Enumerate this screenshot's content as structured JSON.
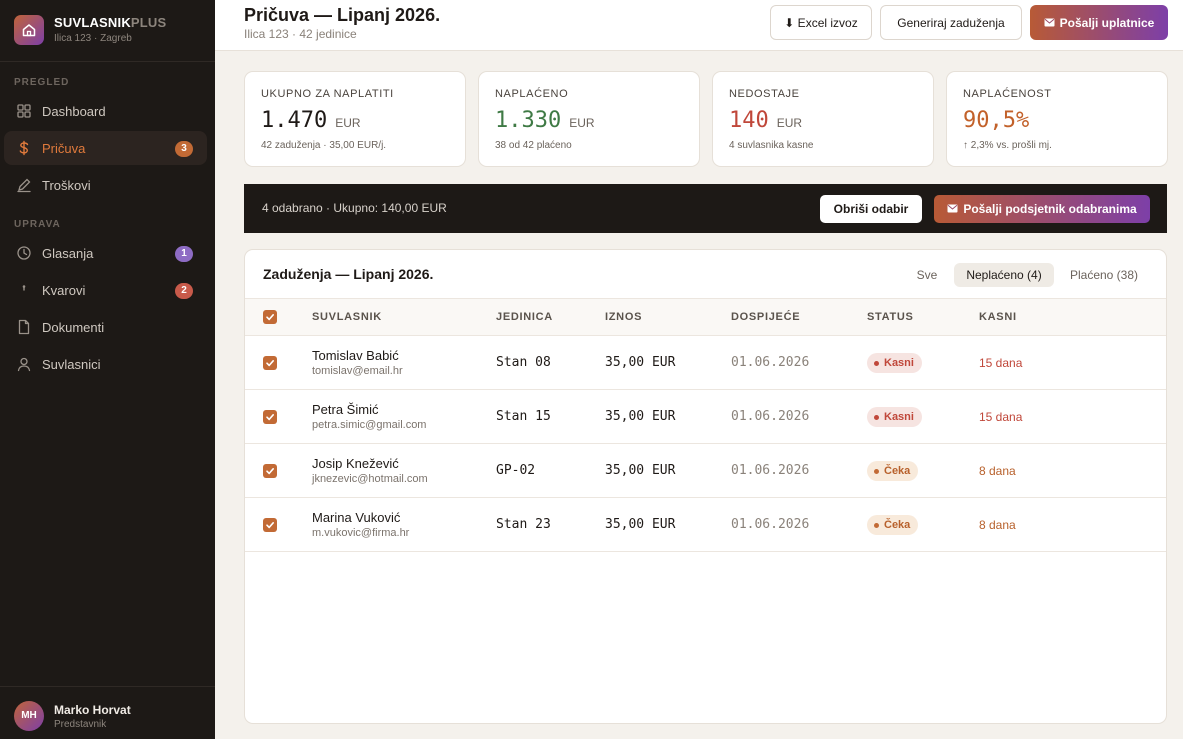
{
  "brand": {
    "name": "SUVLASNIK",
    "name_suffix": "PLUS",
    "address": "Ilica 123 · Zagreb"
  },
  "sidebar": {
    "section_overview": "PREGLED",
    "section_admin": "UPRAVA",
    "items": [
      {
        "label": "Dashboard",
        "icon": "grid-icon"
      },
      {
        "label": "Pričuva",
        "icon": "dollar-icon",
        "badge": "3",
        "active": true
      },
      {
        "label": "Troškovi",
        "icon": "pen-icon"
      },
      {
        "label": "Glasanja",
        "icon": "clock-icon",
        "badge": "1"
      },
      {
        "label": "Kvarovi",
        "icon": "wrench-icon",
        "badge": "2"
      },
      {
        "label": "Dokumenti",
        "icon": "document-icon"
      },
      {
        "label": "Suvlasnici",
        "icon": "user-icon"
      }
    ]
  },
  "user": {
    "initials": "MH",
    "name": "Marko Horvat",
    "role": "Predstavnik"
  },
  "header": {
    "title": "Pričuva — Lipanj 2026.",
    "subtitle": "Ilica 123 · 42 jedinice",
    "export_label": "⬇ Excel izvoz",
    "generate_label": "Generiraj zaduženja",
    "send_label": "Pošalji uplatnice"
  },
  "stats": [
    {
      "label": "UKUPNO ZA NAPLATITI",
      "value": "1.470",
      "unit": "EUR",
      "note": "42 zaduženja · 35,00 EUR/j.",
      "color": "#1f1a17"
    },
    {
      "label": "NAPLAĆENO",
      "value": "1.330",
      "unit": "EUR",
      "note": "38 od 42 plaćeno",
      "color": "#3f7a45"
    },
    {
      "label": "NEDOSTAJE",
      "value": "140",
      "unit": "EUR",
      "note": "4 suvlasnika kasne",
      "color": "#c0473a"
    },
    {
      "label": "NAPLAĆENOST",
      "value": "90,5%",
      "unit": "",
      "note": "↑ 2,3% vs. prošli mj.",
      "color": "#c2612a"
    }
  ],
  "selection": {
    "summary": "4 odabrano · Ukupno: 140,00 EUR",
    "clear_label": "Obriši odabir",
    "remind_label": "Pošalji podsjetnik odabranima"
  },
  "table": {
    "title": "Zaduženja — Lipanj 2026.",
    "filters": [
      {
        "label": "Sve"
      },
      {
        "label": "Neplaćeno (4)",
        "active": true
      },
      {
        "label": "Plaćeno (38)"
      }
    ],
    "columns": [
      "SUVLASNIK",
      "JEDINICA",
      "IZNOS",
      "DOSPIJEĆE",
      "STATUS",
      "KASNI"
    ],
    "rows": [
      {
        "name": "Tomislav Babić",
        "email": "tomislav@email.hr",
        "unit": "Stan 08",
        "amount": "35,00 EUR",
        "due": "01.06.2026",
        "status": "Kasni",
        "late": "15 dana"
      },
      {
        "name": "Petra Šimić",
        "email": "petra.simic@gmail.com",
        "unit": "Stan 15",
        "amount": "35,00 EUR",
        "due": "01.06.2026",
        "status": "Kasni",
        "late": "15 dana"
      },
      {
        "name": "Josip Knežević",
        "email": "jknezevic@hotmail.com",
        "unit": "GP-02",
        "amount": "35,00 EUR",
        "due": "01.06.2026",
        "status": "Čeka",
        "late": "8 dana"
      },
      {
        "name": "Marina Vuković",
        "email": "m.vukovic@firma.hr",
        "unit": "Stan 23",
        "amount": "35,00 EUR",
        "due": "01.06.2026",
        "status": "Čeka",
        "late": "8 dana"
      }
    ]
  },
  "colors": {
    "accent": "#c26a35",
    "late_bg": "#f6e4e1",
    "late_fg": "#c0473a",
    "wait_bg": "#f8eadb",
    "wait_fg": "#b8612c",
    "badge_orange": "#c26a35",
    "badge_purple": "#8e6cc4",
    "badge_red": "#c85a4a"
  }
}
